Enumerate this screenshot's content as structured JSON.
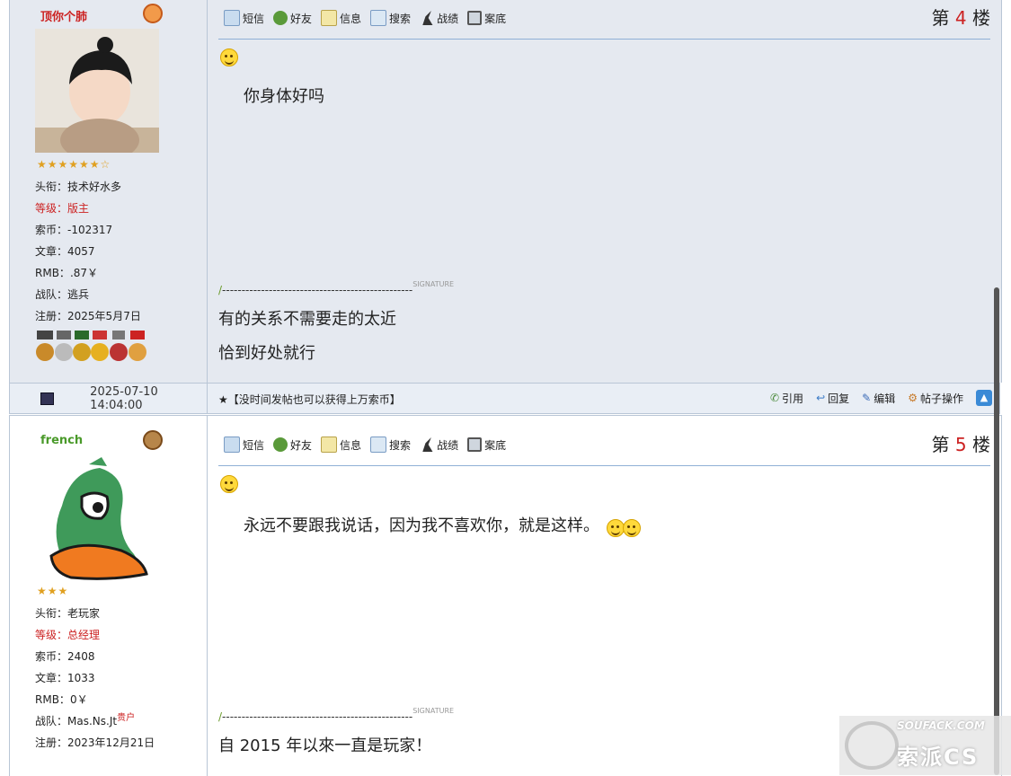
{
  "toolbar": {
    "sms": "短信",
    "friend": "好友",
    "info": "信息",
    "search": "搜索",
    "record": "战绩",
    "file": "案底"
  },
  "signature_tag": "SIGNATURE",
  "signature_dashes": "-------------------------------------------------",
  "posts": [
    {
      "username": "顶你个肺",
      "stars": "★★★★★★☆",
      "rank_label": "头衔：",
      "rank": "技术好水多",
      "level_label": "等级：",
      "level": "版主",
      "coins_label": "索币：",
      "coins": "-102317",
      "articles_label": "文章：",
      "articles": "4057",
      "rmb_label": "RMB：",
      "rmb": ".87￥",
      "team_label": "战队：",
      "team": "逃兵",
      "reg_label": "注册：",
      "reg": "2025年5月7日",
      "floor_prefix": "第",
      "floor_num": "4",
      "floor_suffix": "楼",
      "message": "你身体好吗",
      "signature": [
        "有的关系不需要走的太近",
        "恰到好处就行"
      ]
    },
    {
      "username": "french",
      "stars": "★★★",
      "rank_label": "头衔：",
      "rank": "老玩家",
      "level_label": "等级：",
      "level": "总经理",
      "coins_label": "索币：",
      "coins": "2408",
      "articles_label": "文章：",
      "articles": "1033",
      "rmb_label": "RMB：",
      "rmb": "0￥",
      "team_label": "战队：",
      "team": "Mas.Ns.Jt",
      "team_badge": "贵户",
      "reg_label": "注册：",
      "reg": "2023年12月21日",
      "floor_prefix": "第",
      "floor_num": "5",
      "floor_suffix": "楼",
      "message": "永远不要跟我说话，因为我不喜欢你，就是这样。",
      "signature": [
        "自 2015 年以來一直是玩家！"
      ]
    }
  ],
  "meta": {
    "date": "2025-07-10 14:04:00",
    "notice": "★【没时间发帖也可以获得上万索币】",
    "quote": "引用",
    "reply": "回复",
    "edit": "编辑",
    "post_ops": "帖子操作"
  },
  "watermark": {
    "line1": "SOUFACK.COM",
    "line2": "索派CS"
  },
  "colors": {
    "accent_red": "#cc2222",
    "username_green": "#4a9a2a",
    "post_bg": "#e5e9f0",
    "border": "#b9c6d6"
  }
}
